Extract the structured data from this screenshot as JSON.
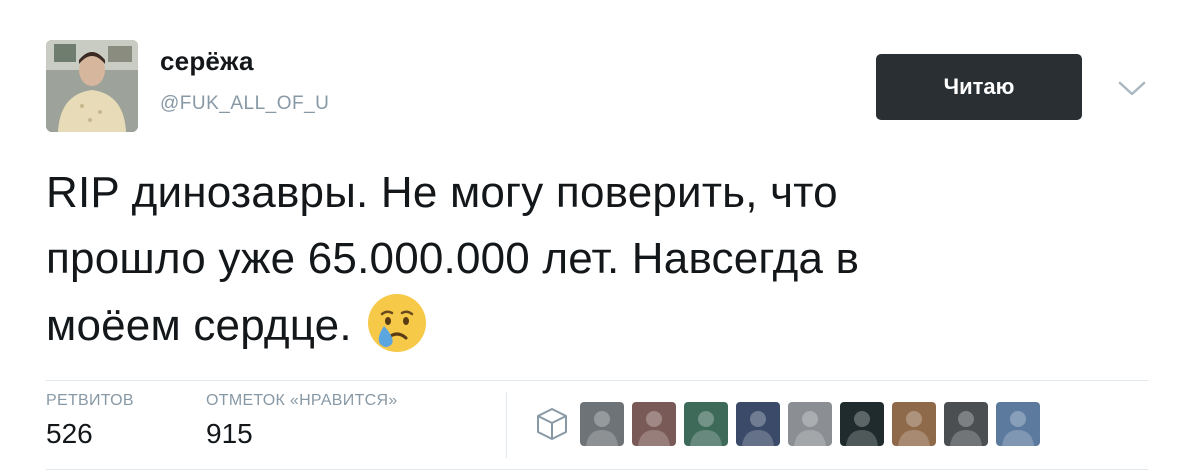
{
  "author": {
    "name": "серёжа",
    "handle": "@FUK_ALL_OF_U",
    "avatar_icon": "user-avatar"
  },
  "follow_button": {
    "label": "Читаю"
  },
  "menu": {
    "icon": "chevron-down-icon"
  },
  "tweet": {
    "lines": [
      "RIP динозавры. Не могу поверить, что",
      "прошло уже 65.000.000 лет. Навсегда в",
      "моёем сердце."
    ],
    "emoji": "crying-face"
  },
  "stats": {
    "retweets_label": "РЕТВИТОВ",
    "retweets_value": "526",
    "likes_label": "ОТМЕТОК «НРАВИТСЯ»",
    "likes_value": "915"
  },
  "liked_by": {
    "icon": "cube-icon",
    "avatars": [
      {
        "color": "#6d7377"
      },
      {
        "color": "#7a5a56"
      },
      {
        "color": "#3e6a5a"
      },
      {
        "color": "#3a4a68"
      },
      {
        "color": "#8b8f93"
      },
      {
        "color": "#1f2b2c"
      },
      {
        "color": "#8f6a4a"
      },
      {
        "color": "#4b4f52"
      },
      {
        "color": "#5b7a9e"
      }
    ]
  },
  "colors": {
    "text": "#14171a",
    "muted": "#8899a6",
    "button_bg": "#292f33",
    "divider": "#e1e8ed"
  }
}
